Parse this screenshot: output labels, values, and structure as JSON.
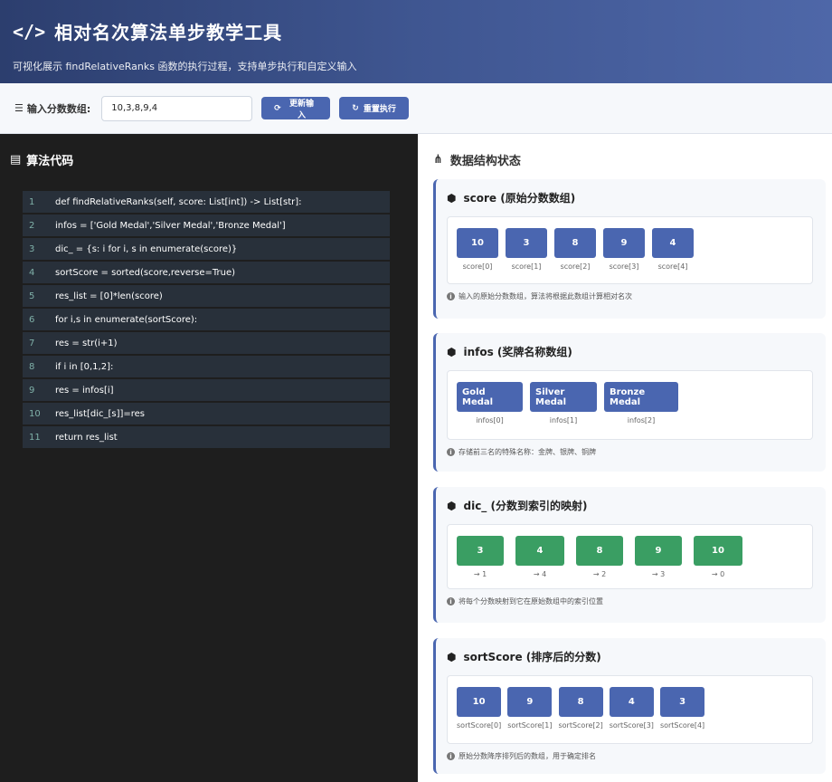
{
  "header": {
    "title": "相对名次算法单步教学工具",
    "subtitle": "可视化展示 findRelativeRanks 函数的执行过程，支持单步执行和自定义输入"
  },
  "input": {
    "label": "输入分数数组:",
    "value": "10,3,8,9,4",
    "update_label": "更新输入",
    "reset_label": "重置执行"
  },
  "code_panel": {
    "title": "算法代码",
    "lines": [
      {
        "n": "1",
        "text": "def findRelativeRanks(self, score: List[int]) -> List[str]:"
      },
      {
        "n": "2",
        "text": "infos = ['Gold Medal','Silver Medal','Bronze Medal']"
      },
      {
        "n": "3",
        "text": "dic_ = {s: i for i, s in enumerate(score)}"
      },
      {
        "n": "4",
        "text": "sortScore = sorted(score,reverse=True)"
      },
      {
        "n": "5",
        "text": "res_list = [0]*len(score)"
      },
      {
        "n": "6",
        "text": "for i,s in enumerate(sortScore):"
      },
      {
        "n": "7",
        "text": "res = str(i+1)"
      },
      {
        "n": "8",
        "text": "if i in [0,1,2]:"
      },
      {
        "n": "9",
        "text": "res = infos[i]"
      },
      {
        "n": "10",
        "text": "res_list[dic_[s]]=res"
      },
      {
        "n": "11",
        "text": "return res_list"
      }
    ]
  },
  "state_panel": {
    "title": "数据结构状态",
    "score": {
      "title": "score (原始分数数组)",
      "items": [
        {
          "v": "10",
          "i": "score[0]"
        },
        {
          "v": "3",
          "i": "score[1]"
        },
        {
          "v": "8",
          "i": "score[2]"
        },
        {
          "v": "9",
          "i": "score[3]"
        },
        {
          "v": "4",
          "i": "score[4]"
        }
      ],
      "note": "输入的原始分数数组，算法将根据此数组计算相对名次"
    },
    "infos": {
      "title": "infos (奖牌名称数组)",
      "items": [
        {
          "v": "Gold Medal",
          "i": "infos[0]"
        },
        {
          "v": "Silver Medal",
          "i": "infos[1]"
        },
        {
          "v": "Bronze Medal",
          "i": "infos[2]"
        }
      ],
      "note": "存储前三名的特殊名称：金牌、银牌、铜牌"
    },
    "dic": {
      "title": "dic_ (分数到索引的映射)",
      "items": [
        {
          "v": "3",
          "i": "→ 1"
        },
        {
          "v": "4",
          "i": "→ 4"
        },
        {
          "v": "8",
          "i": "→ 2"
        },
        {
          "v": "9",
          "i": "→ 3"
        },
        {
          "v": "10",
          "i": "→ 0"
        }
      ],
      "note": "将每个分数映射到它在原始数组中的索引位置"
    },
    "sortScore": {
      "title": "sortScore (排序后的分数)",
      "items": [
        {
          "v": "10",
          "i": "sortScore[0]"
        },
        {
          "v": "9",
          "i": "sortScore[1]"
        },
        {
          "v": "8",
          "i": "sortScore[2]"
        },
        {
          "v": "4",
          "i": "sortScore[3]"
        },
        {
          "v": "3",
          "i": "sortScore[4]"
        }
      ],
      "note": "原始分数降序排列后的数组，用于确定排名"
    }
  },
  "colors": {
    "accent": "#4a66b0",
    "green": "#3a9e63",
    "code_bg": "#1e1e1e"
  }
}
